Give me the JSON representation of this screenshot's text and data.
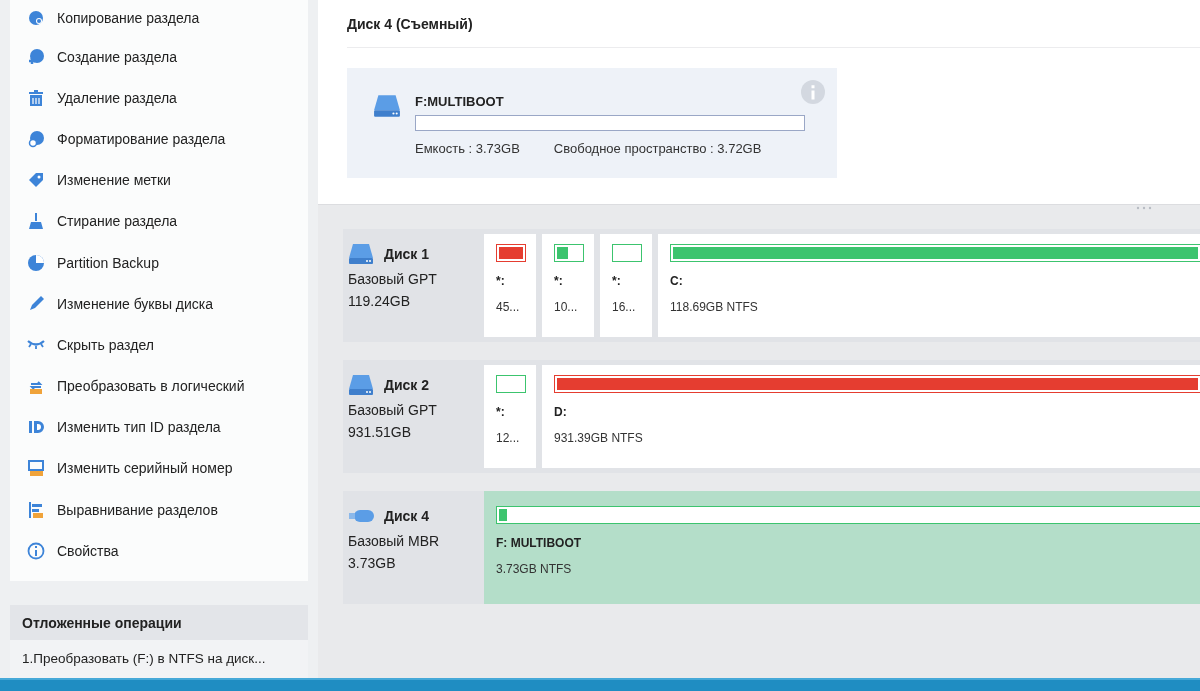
{
  "sidebar": {
    "items": [
      {
        "label": "Копирование раздела"
      },
      {
        "label": "Создание раздела"
      },
      {
        "label": "Удаление раздела"
      },
      {
        "label": "Форматирование раздела"
      },
      {
        "label": "Изменение метки"
      },
      {
        "label": "Стирание раздела"
      },
      {
        "label": "Partition Backup"
      },
      {
        "label": "Изменение буквы диска"
      },
      {
        "label": "Скрыть раздел"
      },
      {
        "label": "Преобразовать в логический"
      },
      {
        "label": "Изменить тип ID раздела"
      },
      {
        "label": "Изменить серийный номер"
      },
      {
        "label": "Выравнивание разделов"
      },
      {
        "label": "Свойства"
      }
    ],
    "pending_title": "Отложенные операции",
    "pending_items": [
      "1.Преобразовать (F:) в NTFS на диск..."
    ]
  },
  "details": {
    "title": "Диск 4 (Съемный)",
    "volume": "F:MULTIBOOT",
    "level": 0.0,
    "capacity": "Емкость : 3.73GB",
    "free": "Свободное пространство : 3.72GB"
  },
  "disks": [
    {
      "kind": "hdd",
      "name": "Диск 1",
      "type": "Базовый GPT",
      "size": "119.24GB",
      "partitions": [
        {
          "label": "*:",
          "size": "45...",
          "color": "#e53d30",
          "level": 1,
          "selected": false
        },
        {
          "label": "*:",
          "size": "10...",
          "color": "#3cc46e",
          "level": 0.45,
          "selected": false
        },
        {
          "label": "*:",
          "size": "16...",
          "color": "#3cc46e",
          "level": 0,
          "selected": false
        },
        {
          "label": "C:",
          "size": "118.69GB NTFS",
          "color": "#3cc46e",
          "level": 1,
          "selected": false
        }
      ]
    },
    {
      "kind": "hdd",
      "name": "Диск 2",
      "type": "Базовый GPT",
      "size": "931.51GB",
      "partitions": [
        {
          "label": "*:",
          "size": "12...",
          "color": "#3cc46e",
          "level": 0,
          "selected": false
        },
        {
          "label": "D:",
          "size": "931.39GB NTFS",
          "color": "#e53d30",
          "level": 1,
          "selected": false
        }
      ]
    },
    {
      "kind": "usb",
      "name": "Диск 4",
      "type": "Базовый MBR",
      "size": "3.73GB",
      "partitions": [
        {
          "label": "F: MULTIBOOT",
          "size": "3.73GB NTFS",
          "color": "#3cc46e",
          "level": 0.012,
          "selected": true
        }
      ]
    }
  ]
}
